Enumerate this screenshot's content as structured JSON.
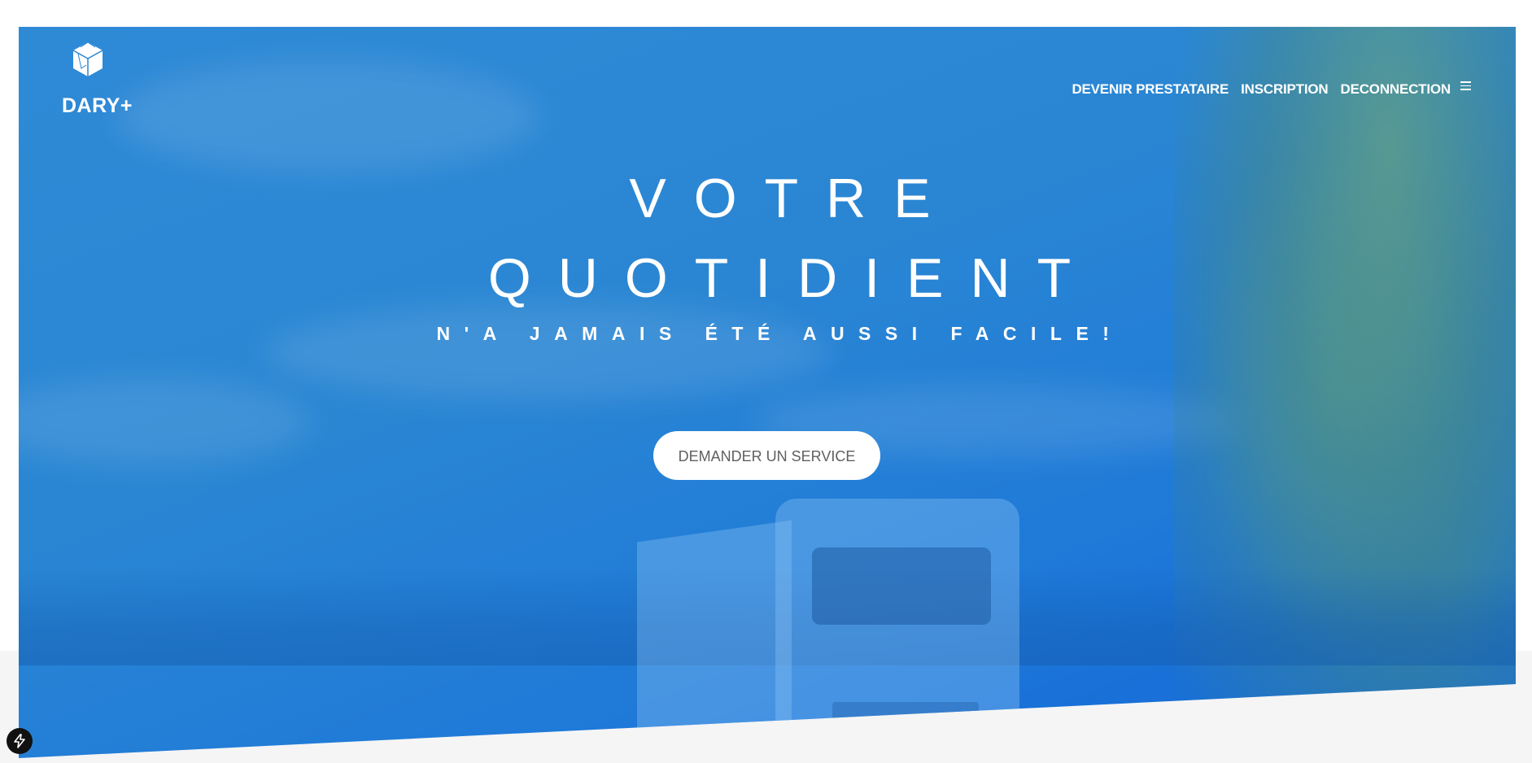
{
  "brand": {
    "name": "DARY+",
    "icon": "house-box-icon"
  },
  "nav": {
    "items": [
      {
        "label": "DEVENIR PRESTATAIRE"
      },
      {
        "label": "INSCRIPTION"
      },
      {
        "label": "DECONNECTION"
      }
    ],
    "menu_icon": "hamburger-icon"
  },
  "hero": {
    "line1": "VOTRE",
    "line2": "QUOTIDIENT",
    "tagline": "N'A JAMAIS ÉTÉ AUSSI FACILE!",
    "cta_label": "DEMANDER UN SERVICE"
  },
  "widgets": {
    "floating_icon": "lightning-icon"
  },
  "colors": {
    "hero_blue": "#2a86d3",
    "hero_blue_deep": "#1165d8",
    "text_white": "#ffffff",
    "cta_text": "#5f5f5f",
    "footer_band": "#f5f5f5"
  }
}
